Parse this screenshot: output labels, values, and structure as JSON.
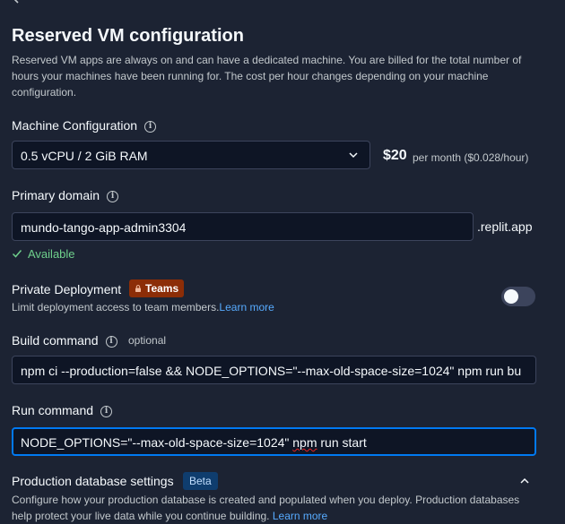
{
  "header": {
    "title": "Reserved VM configuration",
    "description": "Reserved VM apps are always on and can have a dedicated machine. You are billed for the total number of hours your machines have been running for. The cost per hour changes depending on your machine configuration."
  },
  "machine": {
    "label": "Machine Configuration",
    "selected": "0.5 vCPU / 2 GiB RAM",
    "price": "$20",
    "price_detail": "per month ($0.028/hour)"
  },
  "domain": {
    "label": "Primary domain",
    "value": "mundo-tango-app-admin3304",
    "suffix": ".replit.app",
    "status": "Available"
  },
  "private_deployment": {
    "label": "Private Deployment",
    "badge": "Teams",
    "description": "Limit deployment access to team members.",
    "link": "Learn more",
    "enabled": false
  },
  "build": {
    "label": "Build command",
    "optional": "optional",
    "value": "npm ci --production=false && NODE_OPTIONS=\"--max-old-space-size=1024\" npm run bu"
  },
  "run": {
    "label": "Run command",
    "value_prefix": "NODE_OPTIONS=\"--max-old-space-size=1024\" ",
    "value_misspelled": "npm",
    "value_suffix": " run start"
  },
  "production_db": {
    "label": "Production database settings",
    "badge": "Beta",
    "description": "Configure how your production database is created and populated when you deploy. Production databases help protect your live data while you continue building.",
    "link": "Learn more"
  },
  "icons": [
    "chevron-left-icon",
    "info-icon",
    "chevron-down-icon",
    "check-icon",
    "lock-icon",
    "chevron-up-icon"
  ],
  "colors": {
    "background": "#1c2333",
    "input_bg": "#0e1525",
    "accent_focus": "#0079f2",
    "success": "#6fd08c",
    "link": "#57abff",
    "teams_badge": "#8c2d07",
    "beta_badge": "#0f3d6e"
  }
}
